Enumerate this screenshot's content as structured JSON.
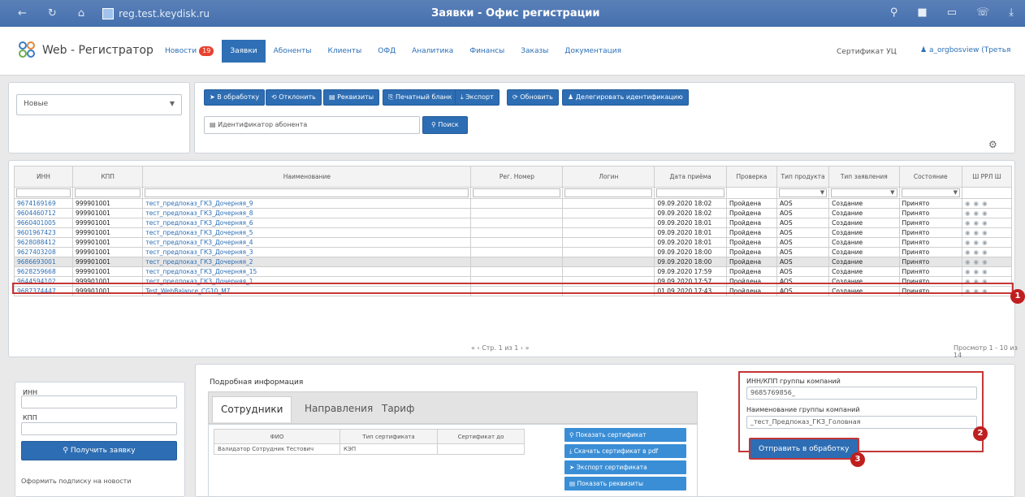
{
  "browser": {
    "nav_icons": [
      "←",
      "↻",
      "⌂"
    ],
    "url": "reg.test.keydisk.ru",
    "window_title": "Заявки - Офис регистрации",
    "icons": [
      "⚲",
      "■",
      "▭",
      "☏",
      "⤓"
    ]
  },
  "header": {
    "brand": "Web - Регистратор",
    "menu": [
      {
        "label": "Новости",
        "badge": "19"
      },
      {
        "label": "Заявки",
        "active": true
      },
      {
        "label": "Абоненты"
      },
      {
        "label": "Клиенты"
      },
      {
        "label": "ОФД"
      },
      {
        "label": "Аналитика"
      },
      {
        "label": "Финансы"
      },
      {
        "label": "Заказы"
      },
      {
        "label": "Документация"
      }
    ],
    "cert": "Сертификат УЦ",
    "user": "a_orgbosview (Третья"
  },
  "toolbar": {
    "status_select": "Новые",
    "buttons": [
      "В обработку",
      "Отклонить",
      "Реквизиты",
      "Печатный бланк",
      "Экспорт",
      "Обновить",
      "Делегировать идентификацию"
    ],
    "search_placeholder": "Идентификатор абонента",
    "search_button": "Поиск"
  },
  "table": {
    "columns": [
      "ИНН",
      "КПП",
      "Наименование",
      "Рег. Номер",
      "Логин",
      "Дата приёма",
      "Проверка",
      "Тип продукта",
      "Тип заявления",
      "Состояние",
      "Ш РРЛ Ш"
    ],
    "rows": [
      [
        "9674169169",
        "999901001",
        "тест_предпоказ_ГКЗ_Дочерняя_9",
        "",
        "",
        "09.09.2020 18:02",
        "Пройдена",
        "AOS",
        "Создание",
        "Принято"
      ],
      [
        "9604460712",
        "999901001",
        "тест_предпоказ_ГКЗ_Дочерняя_8",
        "",
        "",
        "09.09.2020 18:02",
        "Пройдена",
        "AOS",
        "Создание",
        "Принято"
      ],
      [
        "9660401005",
        "999901001",
        "тест_предпоказ_ГКЗ_Дочерняя_6",
        "",
        "",
        "09.09.2020 18:01",
        "Пройдена",
        "AOS",
        "Создание",
        "Принято"
      ],
      [
        "9601967423",
        "999901001",
        "тест_предпоказ_ГКЗ_Дочерняя_5",
        "",
        "",
        "09.09.2020 18:01",
        "Пройдена",
        "AOS",
        "Создание",
        "Принято"
      ],
      [
        "9628088412",
        "999901001",
        "тест_предпоказ_ГКЗ_Дочерняя_4",
        "",
        "",
        "09.09.2020 18:01",
        "Пройдена",
        "AOS",
        "Создание",
        "Принято"
      ],
      [
        "9627403208",
        "999901001",
        "тест_предпоказ_ГКЗ_Дочерняя_3",
        "",
        "",
        "09.09.2020 18:00",
        "Пройдена",
        "AOS",
        "Создание",
        "Принято"
      ],
      [
        "9686693001",
        "999901001",
        "тест_предпоказ_ГКЗ_Дочерняя_2",
        "",
        "",
        "09.09.2020 18:00",
        "Пройдена",
        "AOS",
        "Создание",
        "Принято"
      ],
      [
        "9628259668",
        "999901001",
        "тест_предпоказ_ГКЗ_Дочерняя_15",
        "",
        "",
        "09.09.2020 17:59",
        "Пройдена",
        "AOS",
        "Создание",
        "Принято"
      ],
      [
        "9644594102",
        "999901001",
        "тест_предпоказ_ГКЗ_Дочерняя_1",
        "",
        "",
        "09.09.2020 17:57",
        "Пройдена",
        "AOS",
        "Создание",
        "Принято"
      ],
      [
        "9687374447",
        "999901001",
        "Test_WebBalance_CG10_M7",
        "",
        "",
        "01.09.2020 17:43",
        "Пройдена",
        "AOS",
        "Создание",
        "Принято"
      ]
    ],
    "pager": "Стр. 1 из 1",
    "view_info": "Просмотр 1 - 10 из 14"
  },
  "left_form": {
    "inn_label": "ИНН",
    "kpp_label": "КПП",
    "get_button": "Получить заявку",
    "subscribe_label": "Оформить подписку на новости"
  },
  "details": {
    "title": "Подробная информация",
    "tabs": [
      "Сотрудники",
      "Направления",
      "Тариф"
    ],
    "mini_columns": [
      "ФИО",
      "Тип сертификата",
      "Сертификат до"
    ],
    "mini_rows": [
      [
        "Валидатор Сотрудник Тестович",
        "КЭП",
        ""
      ]
    ],
    "actions": [
      "Показать сертификат",
      "Скачать сертификат в pdf",
      "Экспорт сертификата",
      "Показать реквизиты"
    ]
  },
  "group": {
    "inn_kpp_label": "ИНН/КПП группы компаний",
    "inn_kpp_value": "9685769856_",
    "name_label": "Наименование группы компаний",
    "name_value": "_тест_Предпоказ_ГКЗ_Головная",
    "send_button": "Отправить в обработку"
  },
  "markers": [
    "1",
    "2",
    "3"
  ],
  "colors": {
    "accent": "#2d6db3",
    "highlight": "#c53636"
  }
}
